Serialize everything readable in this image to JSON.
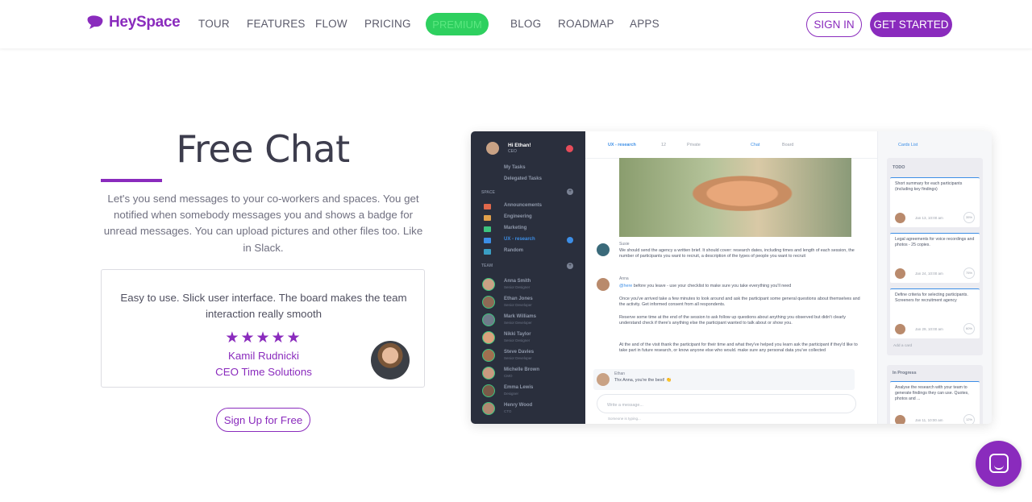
{
  "brand": {
    "name": "HeySpace",
    "color": "#8a2bbd",
    "premium_color": "#2ed05f"
  },
  "nav": {
    "items": [
      "TOUR",
      "FEATURES",
      "FLOW",
      "PRICING",
      "PREMIUM",
      "BLOG",
      "ROADMAP",
      "APPS"
    ],
    "signin": "SIGN IN",
    "get_started": "GET STARTED"
  },
  "hero": {
    "title": "Free Chat",
    "description": "Let's you send messages to your co-workers and spaces. You get notified when somebody messages you and shows a badge for unread messages. You can upload pictures and other files too. Like in Slack.",
    "testimonial": {
      "quote": "Easy to use. Slick user interface. The board makes the team interaction really smooth",
      "rating": 5,
      "stars": "★★★★★",
      "name": "Kamil Rudnicki",
      "company": "CEO Time Solutions"
    },
    "signup": "Sign Up for Free"
  },
  "mockup": {
    "sidebar": {
      "greeting": "Hi Ethan!",
      "role": "CEO",
      "items": [
        "My Tasks",
        "Delegated Tasks"
      ],
      "space_label": "SPACE",
      "spaces": [
        "Announcements",
        "Engineering",
        "Marketing",
        "UX - research",
        "Random"
      ],
      "team_label": "TEAM",
      "team": [
        {
          "name": "Anna Smith",
          "role": "Senior Designer"
        },
        {
          "name": "Ethan Jones",
          "role": "Senior Developer"
        },
        {
          "name": "Mark Williams",
          "role": "Senior Developer"
        },
        {
          "name": "Nikki Taylor",
          "role": "Senior Designer"
        },
        {
          "name": "Steve Davies",
          "role": "Senior Developer"
        },
        {
          "name": "Michelle Brown",
          "role": "CMO"
        },
        {
          "name": "Emma Lewis",
          "role": "Designer"
        },
        {
          "name": "Henry Wood",
          "role": "CTO"
        }
      ]
    },
    "channel": {
      "name": "UX - research",
      "members": "12",
      "privacy": "Private",
      "tab_chat": "Chat",
      "tab_board": "Board"
    },
    "messages": [
      {
        "name": "Susie",
        "text": "We should send the agency a written brief. It should cover: research dates, including times and length of each session, the number of participants you want to recruit, a description of the types of people you want to recruit"
      },
      {
        "name": "Anna",
        "mention": "@here",
        "text": " before you leave - use your checklist to make sure you take everything you'll need"
      },
      {
        "text": "Once you've arrived take a few minutes to look around and ask the participant some general questions about themselves and the activity. Get informed consent from all respondents."
      },
      {
        "text": "Reserve some time at the end of the session to ask follow up questions about anything you observed but didn't clearly understand check if there's anything else the participant wanted to talk about or show you."
      },
      {
        "text": "At the and of the visit thank the participant for their time and what they've helped you learn ask the participant if they'd like to take part in future research, or know anyone else who would. make sure any personal data you've collected"
      }
    ],
    "reply": {
      "name": "Ethan",
      "text": "Thx Anna, you're the best! 👏"
    },
    "input_placeholder": "Write a message...",
    "typing": "Someone is typing...",
    "cards": {
      "title": "Cards List",
      "todo_label": "TODO",
      "todo": [
        {
          "text": "Short summary for each participants (including key findings)",
          "date": "Jan 13, 10:00 am",
          "pct": "35%"
        },
        {
          "text": "Legal agreements for voice recordings and photos - 25 copies.",
          "date": "Jan 24, 10:00 am",
          "pct": "75%"
        },
        {
          "text": "Define criteria for selecting participants. Screeners for recruitment agency",
          "date": "Jan 29, 10:00 am",
          "pct": "60%"
        }
      ],
      "add_card": "Add a card",
      "progress_label": "In Progress",
      "progress": [
        {
          "text": "Analyse the research with your team to generate findings they can use. Quotes, photos and ...",
          "date": "Jan 11, 10:00 am",
          "pct": "12%"
        }
      ]
    }
  }
}
